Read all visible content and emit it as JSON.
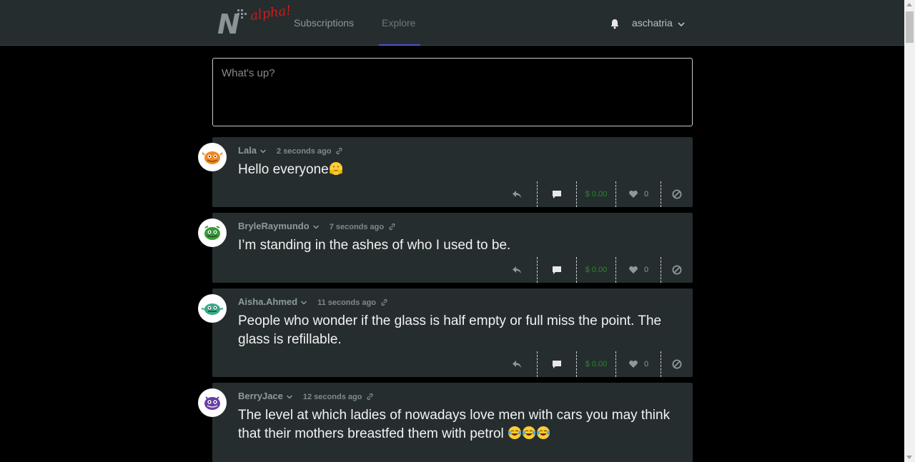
{
  "nav": {
    "logo_letter": "N",
    "logo_badge": "alpha!",
    "tabs": [
      {
        "label": "Subscriptions"
      },
      {
        "label": "Explore"
      }
    ],
    "active_tab": "Explore",
    "username": "aschatria"
  },
  "compose": {
    "placeholder": "What's up?"
  },
  "posts": [
    {
      "username": "Lala",
      "time": "2 seconds ago",
      "text": "Hello everyone",
      "emoji": [
        "hugging-face"
      ],
      "money": "$ 0.00",
      "likes": "0",
      "avatar_color": "#f08a24"
    },
    {
      "username": "BryleRaymundo",
      "time": "7 seconds ago",
      "text": "I’m standing in the ashes of who I used to be.",
      "emoji": [],
      "money": "$ 0.00",
      "likes": "0",
      "avatar_color": "#3a9a3a"
    },
    {
      "username": "Aisha.Ahmed",
      "time": "11 seconds ago",
      "text": "People who wonder if the glass is half empty or full miss the point. The glass is refillable.",
      "emoji": [],
      "money": "$ 0.00",
      "likes": "0",
      "avatar_color": "#3aa88a"
    },
    {
      "username": "BerryJace",
      "time": "12 seconds ago",
      "text": "The level at which ladies of nowadays love men with cars you may think that their mothers breastfed them with petrol",
      "emoji": [
        "tears-of-joy",
        "tears-of-joy",
        "tears-of-joy"
      ],
      "money": "$ 0.00",
      "likes": "0",
      "avatar_color": "#6a3fa8"
    }
  ],
  "colors": {
    "topbar": "#252d2f",
    "card": "#252d2f",
    "money": "#1f8f1f",
    "active_tab_underline": "#4a55d6",
    "logo_badge": "#d11a1a"
  }
}
